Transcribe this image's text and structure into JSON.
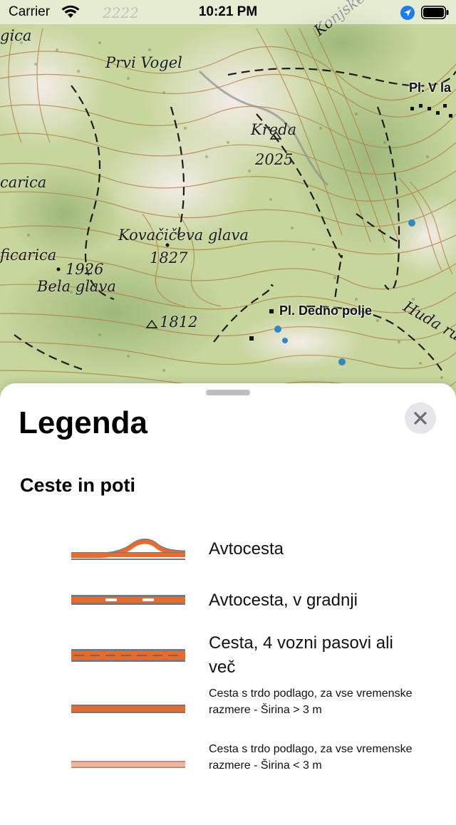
{
  "status_bar": {
    "carrier": "Carrier",
    "time": "10:21 PM",
    "wifi_icon": "wifi-icon",
    "location_icon": "location-arrow-icon",
    "battery_icon": "battery-icon"
  },
  "map": {
    "labels": {
      "elevation_top": "2222",
      "prvi_vogel": "Prvi Vogel",
      "konjske_polje": "Konjske polje",
      "kreda": "Kreda",
      "kreda_elev": "2025",
      "carica": "carica",
      "kovaciceva_glava": "Kovačičeva glava",
      "kovaciceva_elev": "1827",
      "ficarica": "ficarica",
      "bela_glava_elev": "1926",
      "bela_glava": "Bela glava",
      "peak_1812": "1812",
      "huda_ru": "Huda ru",
      "gica": "gica"
    },
    "poi": {
      "pl_v_la": "Pl. V la",
      "pl_dedno_polje": "Pl. Dedno polje"
    }
  },
  "legend": {
    "title": "Legenda",
    "close_icon": "close-icon",
    "section_title": "Ceste in poti",
    "items": [
      {
        "label": "Avtocesta",
        "symbol": "motorway"
      },
      {
        "label": "Avtocesta, v gradnji",
        "symbol": "motorway-under-construction"
      },
      {
        "label": "Cesta, 4 vozni pasovi ali več",
        "symbol": "road-4-lanes"
      },
      {
        "label": "Cesta s trdo podlago, za vse vremenske razmere - Širina > 3 m",
        "symbol": "paved-road-wide"
      },
      {
        "label": "Cesta s trdo podlago, za vse vremenske razmere - Širina < 3 m",
        "symbol": "paved-road-narrow"
      }
    ]
  },
  "colors": {
    "road_orange": "#e96b2b",
    "road_gray": "#6f7b85",
    "road_light": "#f2b595",
    "map_green": "#c8d79e"
  }
}
